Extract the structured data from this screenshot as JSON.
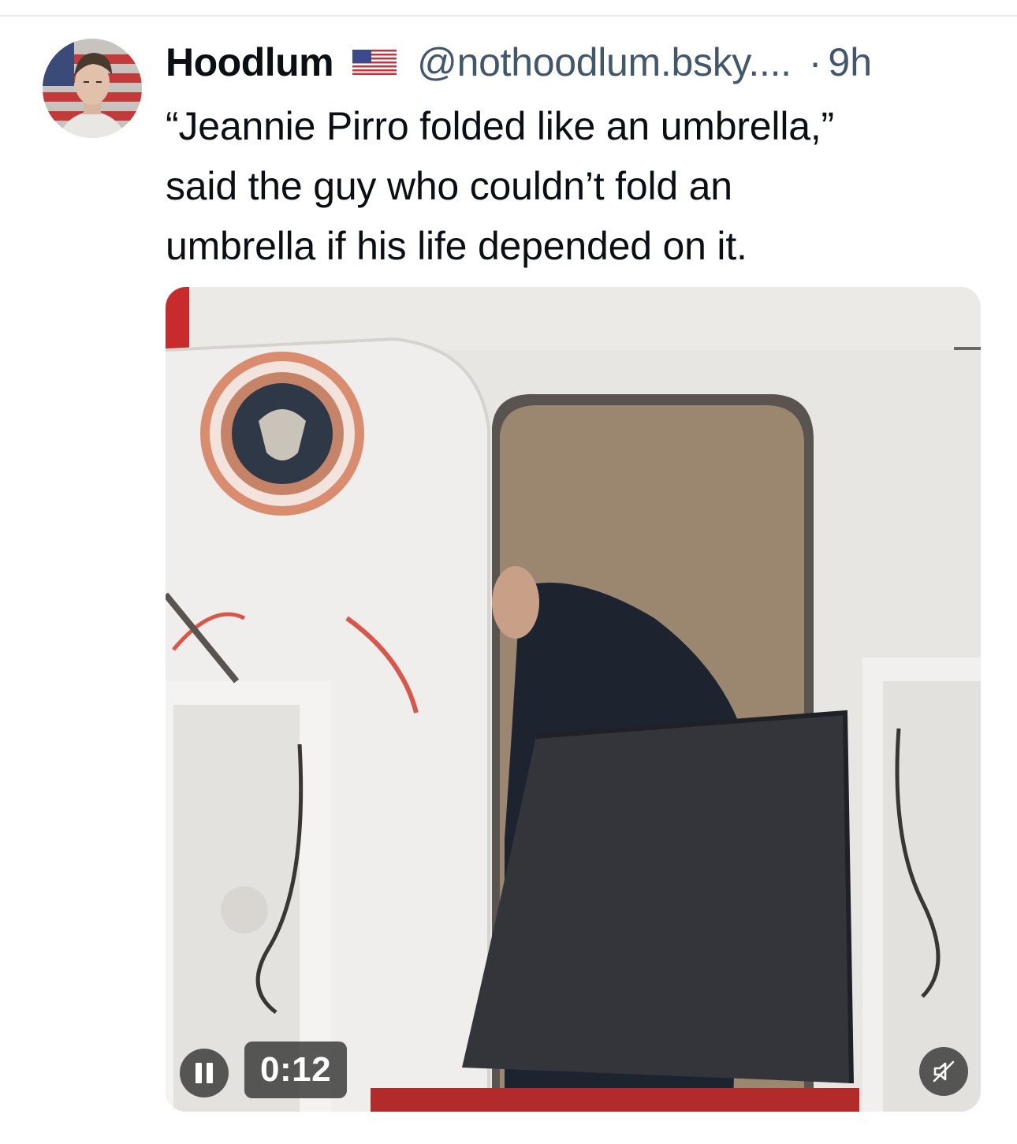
{
  "post": {
    "display_name": "Hoodlum",
    "flag_icon": "us-flag-icon",
    "handle": "@nothoodlum.bsky....",
    "separator": "·",
    "timestamp": "9h",
    "text": "“Jeannie Pirro folded like an umbrella,”\nsaid the guy who couldn’t fold an\numbrella if his life depended on it."
  },
  "video": {
    "elapsed": "0:12",
    "state": "playing",
    "muted": true,
    "controls": {
      "pause_icon": "pause-icon",
      "mute_icon": "speaker-muted-icon"
    }
  }
}
